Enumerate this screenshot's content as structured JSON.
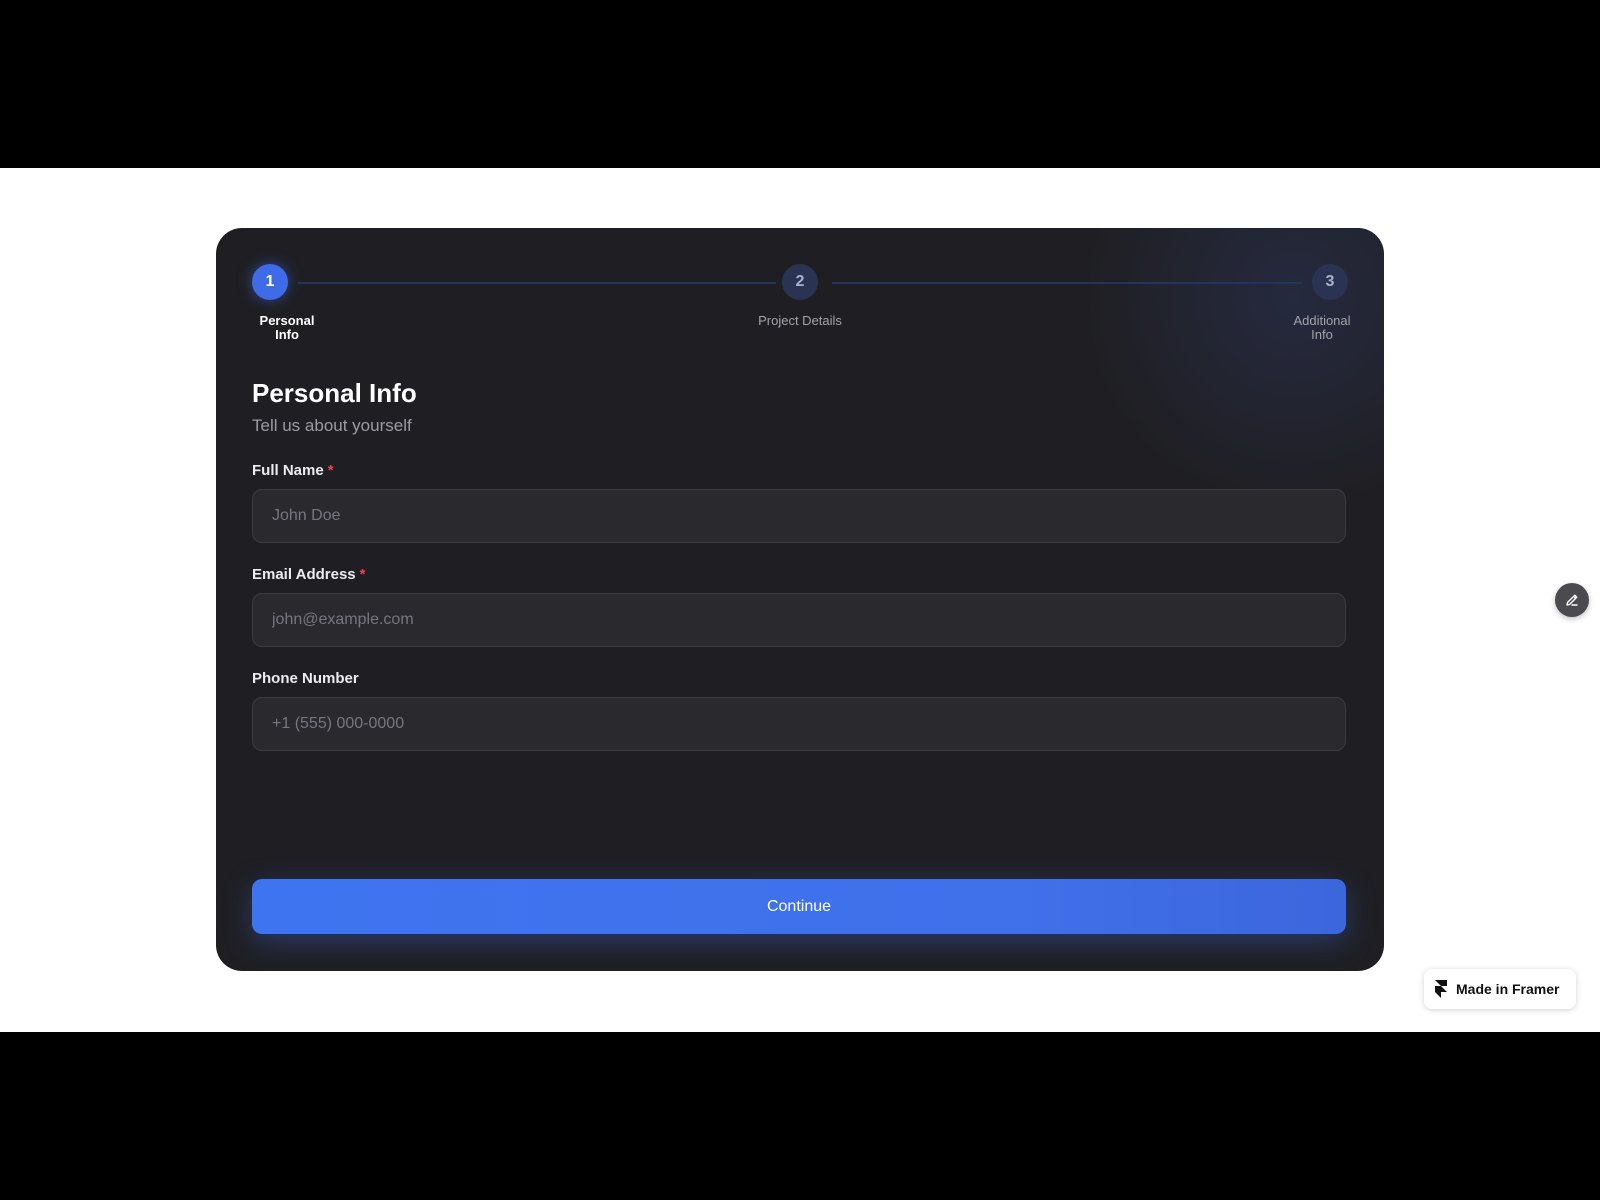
{
  "stepper": {
    "steps": [
      {
        "number": "1",
        "label_line1": "Personal",
        "label_line2": "Info",
        "state": "active"
      },
      {
        "number": "2",
        "label_line1": "Project Details",
        "label_line2": "",
        "state": "inactive"
      },
      {
        "number": "3",
        "label_line1": "Additional",
        "label_line2": "Info",
        "state": "inactive"
      }
    ]
  },
  "form": {
    "title": "Personal Info",
    "subtitle": "Tell us about yourself",
    "required_marker": "*",
    "fields": [
      {
        "label": "Full Name",
        "required": true,
        "placeholder": "John Doe",
        "value": ""
      },
      {
        "label": "Email Address",
        "required": true,
        "placeholder": "john@example.com",
        "value": ""
      },
      {
        "label": "Phone Number",
        "required": false,
        "placeholder": "+1 (555) 000-0000",
        "value": ""
      }
    ],
    "submit_label": "Continue"
  },
  "overlay": {
    "edit_button_icon": "pencil-icon",
    "framer_badge_label": "Made in Framer",
    "framer_badge_icon": "framer-logo-icon"
  },
  "colors": {
    "accent": "#3f6ae8",
    "card_background": "#1f1f23",
    "input_background": "#2a2a2e",
    "required": "#e5484d"
  }
}
